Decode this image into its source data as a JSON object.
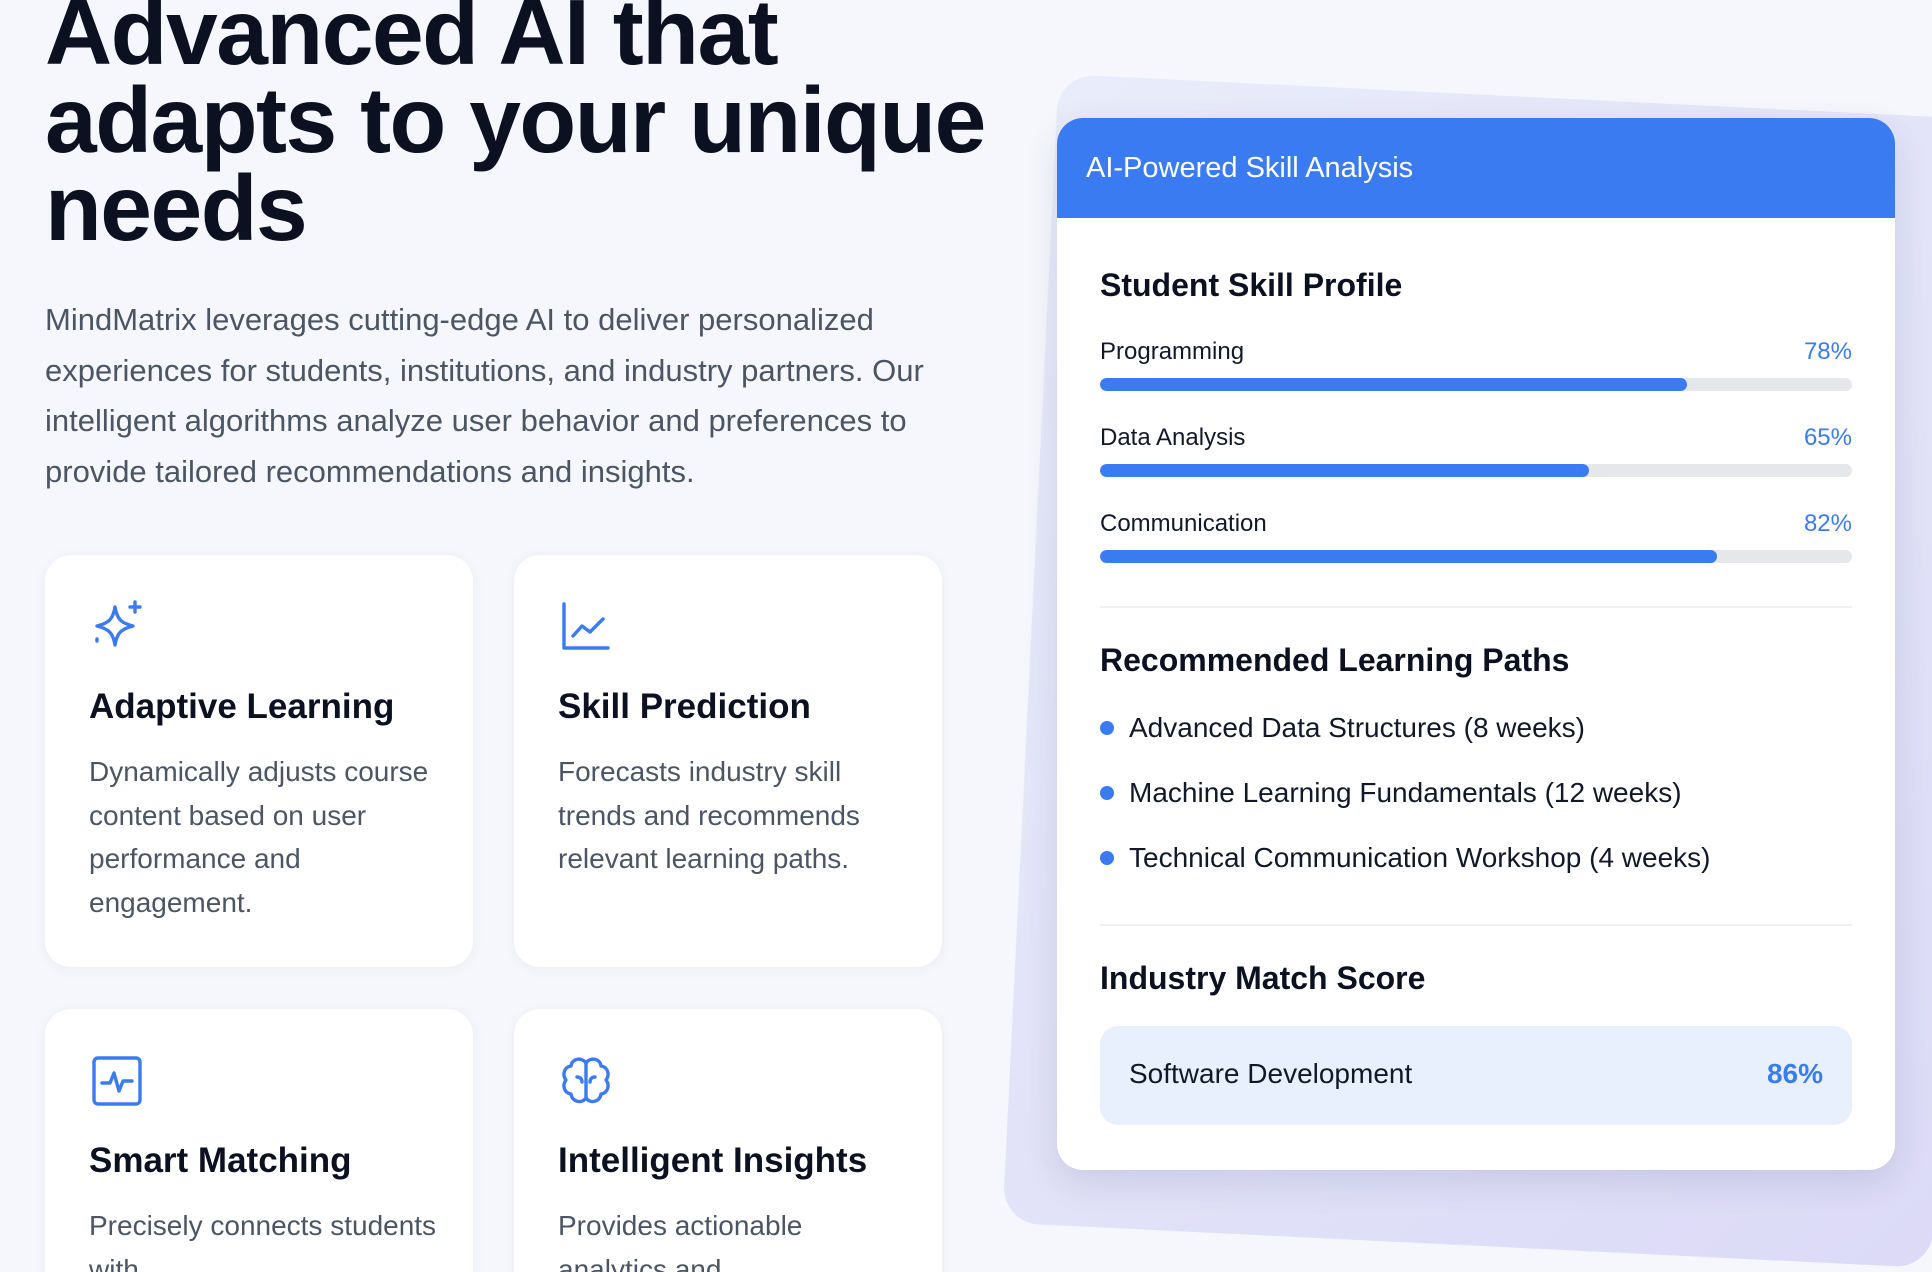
{
  "hero": {
    "title": "Advanced AI that\nadapts to your unique\nneeds",
    "description": "MindMatrix leverages cutting-edge AI to deliver personalized experiences for students, institutions, and industry partners. Our intelligent algorithms analyze user behavior and preferences to provide tailored recommendations and insights."
  },
  "features": [
    {
      "icon": "sparkles-icon",
      "title": "Adaptive Learning",
      "description": "Dynamically adjusts course content based on user performance and engagement."
    },
    {
      "icon": "chart-line-icon",
      "title": "Skill Prediction",
      "description": "Forecasts industry skill trends and recommends relevant learning paths."
    },
    {
      "icon": "activity-icon",
      "title": "Smart Matching",
      "description": "Precisely connects students with"
    },
    {
      "icon": "brain-icon",
      "title": "Intelligent Insights",
      "description": "Provides actionable analytics and"
    }
  ],
  "panel": {
    "header": "AI-Powered Skill Analysis",
    "skill_profile_title": "Student Skill Profile",
    "skills": [
      {
        "label": "Programming",
        "percent_text": "78%",
        "value": 78
      },
      {
        "label": "Data Analysis",
        "percent_text": "65%",
        "value": 65
      },
      {
        "label": "Communication",
        "percent_text": "82%",
        "value": 82
      }
    ],
    "paths_title": "Recommended Learning Paths",
    "paths": [
      "Advanced Data Structures (8 weeks)",
      "Machine Learning Fundamentals (12 weeks)",
      "Technical Communication Workshop (4 weeks)"
    ],
    "match_title": "Industry Match Score",
    "match": {
      "label": "Software Development",
      "value": "86%"
    }
  },
  "colors": {
    "accent": "#3b7bf2",
    "background": "#f5f7fc",
    "heading": "#0b1120",
    "body_text": "#4b5563",
    "match_box": "#e8f0fd"
  }
}
